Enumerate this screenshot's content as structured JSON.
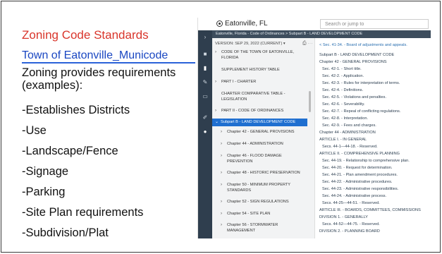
{
  "slide": {
    "title": "Zoning Code Standards",
    "link": "Town of Eatonville_Municode",
    "body": "Zoning provides requirements (examples):",
    "bullets": [
      "-Establishes Districts",
      "-Use",
      "-Landscape/Fence",
      "-Signage",
      "-Parking",
      "-Site Plan requirements",
      "-Subdivision/Plat"
    ]
  },
  "screenshot": {
    "site_title": "Eatonville, FL",
    "search_placeholder": "Search or jump to",
    "breadcrumb": "Eatonville, Florida - Code of Ordinances > Subpart B - LAND DEVELOPMENT CODE",
    "version": "VERSION: SEP 29, 2022 (CURRENT) ▾",
    "toc": [
      "CODE OF THE TOWN OF EATONVILLE,",
      "FLORIDA",
      "SUPPLEMENT HISTORY TABLE",
      "PART I - CHARTER",
      "CHARTER COMPARATIVE TABLE -",
      "LEGISLATION",
      "PART II - CODE OF ORDINANCES",
      "Subpart B - LAND DEVELOPMENT CODE",
      "Chapter 42 - GENERAL PROVISIONS",
      "Chapter 44 - ADMINISTRATION",
      "Chapter 46 - FLOOD DAMAGE",
      "PREVENTION",
      "Chapter 48 - HISTORIC PRESERVATION",
      "Chapter 50 - MINIMUM PROPERTY",
      "STANDARDS",
      "Chapter 52 - SIGN REGULATIONS",
      "Chapter 54 - SITE PLAN",
      "Chapter 56 - STORMWATER",
      "MANAGEMENT",
      "Chapter 58 - SUBDIVISION REGULATIONS",
      "Chapter 60 - SUPPLEMENTAL ZONING",
      "DISTRICT REGULATIONS"
    ],
    "content_back": "< Sec. 41-34. - Board of adjustments and appeals.",
    "content": [
      "Subpart B - LAND DEVELOPMENT CODE",
      "Chapter 42 - GENERAL PROVISIONS",
      "Sec. 42-1. - Short title.",
      "Sec. 42-2. - Application.",
      "Sec. 42-3. - Rules for interpretation of terms.",
      "Sec. 42-4. - Definitions.",
      "Sec. 42-5. - Violations and penalties.",
      "Sec. 42-6. - Severability.",
      "Sec. 42-7. - Repeal of conflicting regulations.",
      "Sec. 42-8. - Interpretation.",
      "Sec. 42-9. - Fees and charges.",
      "Chapter 44 - ADMINISTRATION",
      "ARTICLE I. - IN GENERAL",
      "Secs. 44-1—44-18. - Reserved.",
      "ARTICLE II. - COMPREHENSIVE PLANNING",
      "Sec. 44-19. - Relationship to comprehensive plan.",
      "Sec. 44-20. - Request for determination.",
      "Sec. 44-21. - Plan amendment procedures.",
      "Sec. 44-22. - Administrative procedures.",
      "Sec. 44-23. - Administrative responsibilities.",
      "Sec. 44-24. - Administrative process.",
      "Secs. 44-25—44-51. - Reserved.",
      "ARTICLE III. - BOARDS, COMMITTEES, COMMISSIONS",
      "DIVISION 1. - GENERALLY",
      "Secs. 44-52—44-75. - Reserved.",
      "DIVISION 2. - PLANNING BOARD"
    ]
  }
}
